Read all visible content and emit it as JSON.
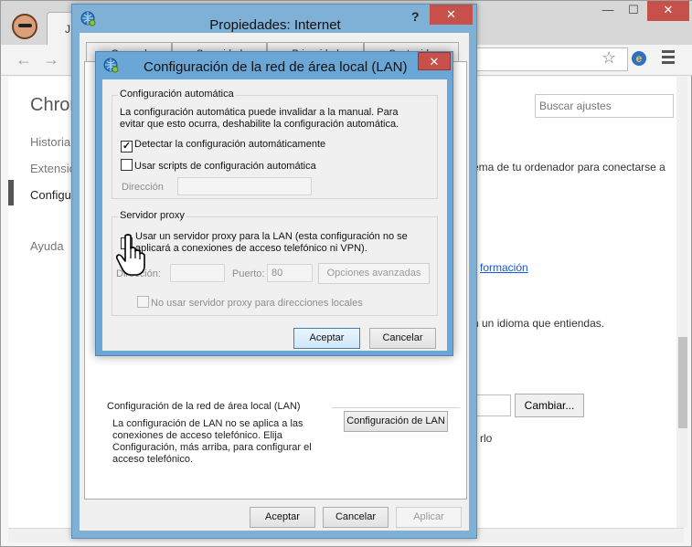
{
  "chrome": {
    "tab_title": "J",
    "app_title": "Chron",
    "sidebar": [
      "Historial",
      "Extensiones",
      "Configuración",
      "Ayuda"
    ],
    "search_placeholder": "Buscar ajustes",
    "content_lines": [
      "ema de tu ordenador para conectarse a",
      "formación",
      "n un idioma que entiendas.",
      "rlo"
    ],
    "change_button": "Cambiar...",
    "window_buttons": {
      "minimize": "—",
      "maximize": "☐",
      "close": "✕"
    }
  },
  "props": {
    "title": "Propiedades: Internet",
    "help": "?",
    "close": "✕",
    "tabs": [
      "General",
      "Seguridad",
      "Privacidad",
      "Contenido"
    ],
    "lan_section_title": "Configuración de la red de área local (LAN)",
    "lan_section_desc": "La configuración de LAN no se aplica a las conexiones de acceso telefónico. Elija Configuración, más arriba, para configurar el acceso telefónico.",
    "lan_button": "Configuración de LAN",
    "ok": "Aceptar",
    "cancel": "Cancelar",
    "apply": "Aplicar"
  },
  "lan": {
    "title": "Configuración de la red de área local (LAN)",
    "close": "✕",
    "auto_group": "Configuración automática",
    "auto_desc": "La configuración automática puede invalidar a la manual. Para evitar que esto ocurra, deshabilite la configuración automática.",
    "detect_label": "Detectar la configuración automáticamente",
    "detect_checked": true,
    "scripts_label": "Usar scripts de configuración automática",
    "scripts_checked": false,
    "address_label": "Dirección",
    "address_value": "",
    "proxy_group": "Servidor proxy",
    "proxy_label": "Usar un servidor proxy para la LAN (esta configuración no se aplicará a conexiones de acceso telefónico ni VPN).",
    "proxy_checked": false,
    "proxy_address_label": "Dirección:",
    "proxy_address_value": "",
    "port_label": "Puerto:",
    "port_value": "80",
    "advanced_button": "Opciones avanzadas",
    "bypass_label": "No usar servidor proxy para direcciones locales",
    "bypass_checked": false,
    "ok": "Aceptar",
    "cancel": "Cancelar",
    "check_mark": "✓"
  }
}
